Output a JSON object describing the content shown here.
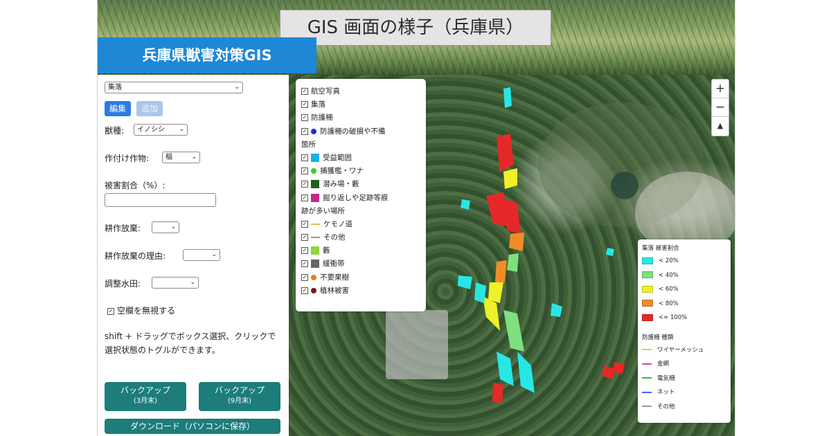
{
  "banner": {
    "title": "GIS 画面の様子（兵庫県）"
  },
  "app": {
    "title": "兵庫県獣害対策GIS"
  },
  "sidebar": {
    "layer_select": "集落",
    "edit_label": "編集",
    "add_label": "追加",
    "animal_label": "獣種:",
    "animal_value": "イノシシ",
    "crop_label": "作付け作物:",
    "crop_value": "稲",
    "damage_label": "被害割合（%）:",
    "abandon_label": "耕作放棄:",
    "abandon_reason_label": "耕作放棄の理由:",
    "paddy_label": "調整水田:",
    "ignore_empty_label": "空欄を無視する",
    "help_text": "shift + ドラッグでボックス選択、クリックで選択状態のトグルができます。",
    "backup1_line1": "バックアップ",
    "backup1_line2": "(3月末)",
    "backup2_line1": "バックアップ",
    "backup2_line2": "(9月末)",
    "download_label": "ダウンロード（パソコンに保存）"
  },
  "zoom": {
    "in": "+",
    "out": "−",
    "north": "▲"
  },
  "layers": [
    {
      "label": "航空写真",
      "kind": "none",
      "color": ""
    },
    {
      "label": "集落",
      "kind": "none",
      "color": ""
    },
    {
      "label": "防護柵",
      "kind": "none",
      "color": ""
    },
    {
      "label": "防護柵の破損や不備",
      "kind": "dot",
      "color": "#1a2fd6"
    },
    {
      "label": "箇所",
      "kind": "cont",
      "color": ""
    },
    {
      "label": "受益範囲",
      "kind": "swatch",
      "color": "#1ab0e6"
    },
    {
      "label": "捕獲檻・ワナ",
      "kind": "dot",
      "color": "#33cc33"
    },
    {
      "label": "潜み場・藪",
      "kind": "swatch",
      "color": "#1f5e1f"
    },
    {
      "label": "掘り返しや足跡等痕",
      "kind": "swatch",
      "color": "#c0288e"
    },
    {
      "label": "跡が多い場所",
      "kind": "cont",
      "color": ""
    },
    {
      "label": "ケモノ道",
      "kind": "line",
      "color": "#e8b84a"
    },
    {
      "label": "その他",
      "kind": "line",
      "color": "#c98080"
    },
    {
      "label": "藪",
      "kind": "swatch",
      "color": "#8fd63a"
    },
    {
      "label": "緩衝帯",
      "kind": "swatch",
      "color": "#666666"
    },
    {
      "label": "不要果樹",
      "kind": "dot",
      "color": "#f07d1a"
    },
    {
      "label": "植林被害",
      "kind": "dot",
      "color": "#7a1414"
    }
  ],
  "legend": {
    "damage_title": "集落 被害割合",
    "damage_items": [
      {
        "label": "< 20%",
        "color": "#28e6e6"
      },
      {
        "label": "< 40%",
        "color": "#7ee07e"
      },
      {
        "label": "< 60%",
        "color": "#f0f028"
      },
      {
        "label": "< 80%",
        "color": "#f08c28"
      },
      {
        "label": "<= 100%",
        "color": "#e62828"
      }
    ],
    "fence_title": "防護柵 種類",
    "fence_items": [
      {
        "label": "ワイヤーメッシュ",
        "color": "#f0c060"
      },
      {
        "label": "金網",
        "color": "#e05070"
      },
      {
        "label": "電気柵",
        "color": "#3cb44b"
      },
      {
        "label": "ネット",
        "color": "#3c6cf0"
      },
      {
        "label": "その他",
        "color": "#9a9a9a"
      }
    ]
  }
}
